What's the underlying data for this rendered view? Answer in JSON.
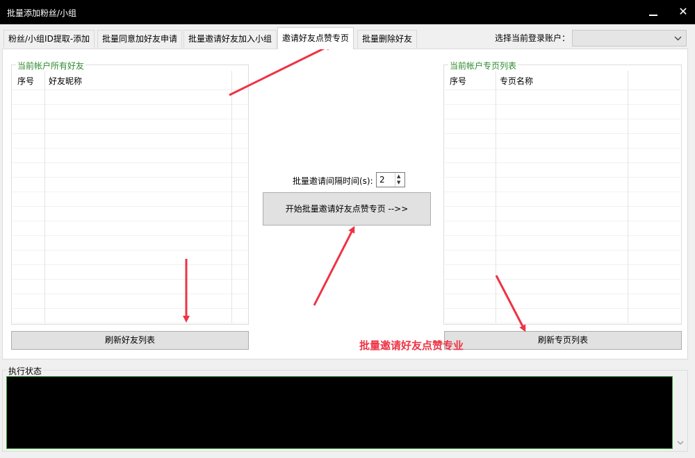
{
  "window": {
    "title": "批量添加粉丝/小组",
    "minimize_icon": "minimize-icon",
    "close_icon": "close-icon",
    "close_glyph": "✕"
  },
  "tabs": [
    {
      "label": "粉丝/小组ID提取-添加"
    },
    {
      "label": "批量同意加好友申请"
    },
    {
      "label": "批量邀请好友加入小组"
    },
    {
      "label": "邀请好友点赞专页"
    },
    {
      "label": "批量删除好友"
    }
  ],
  "account": {
    "label": "选择当前登录账户：",
    "selected": ""
  },
  "friends": {
    "group_label": "当前帐户所有好友",
    "columns": [
      "序号",
      "好友昵称"
    ],
    "refresh_label": "刷新好友列表"
  },
  "pages": {
    "group_label": "当前帐户专页列表",
    "columns": [
      "序号",
      "专页名称"
    ],
    "refresh_label": "刷新专页列表"
  },
  "invite": {
    "interval_label": "批量邀请间隔时间(s):",
    "interval_value": "2",
    "start_label": "开始批量邀请好友点赞专页  -->>"
  },
  "annotation": "批量邀请好友点赞专业",
  "status": {
    "label": "执行状态",
    "text": ""
  },
  "colors": {
    "accent_green": "#2e8b2e",
    "annotation_red": "#ee3344",
    "console_bg": "#000000"
  }
}
